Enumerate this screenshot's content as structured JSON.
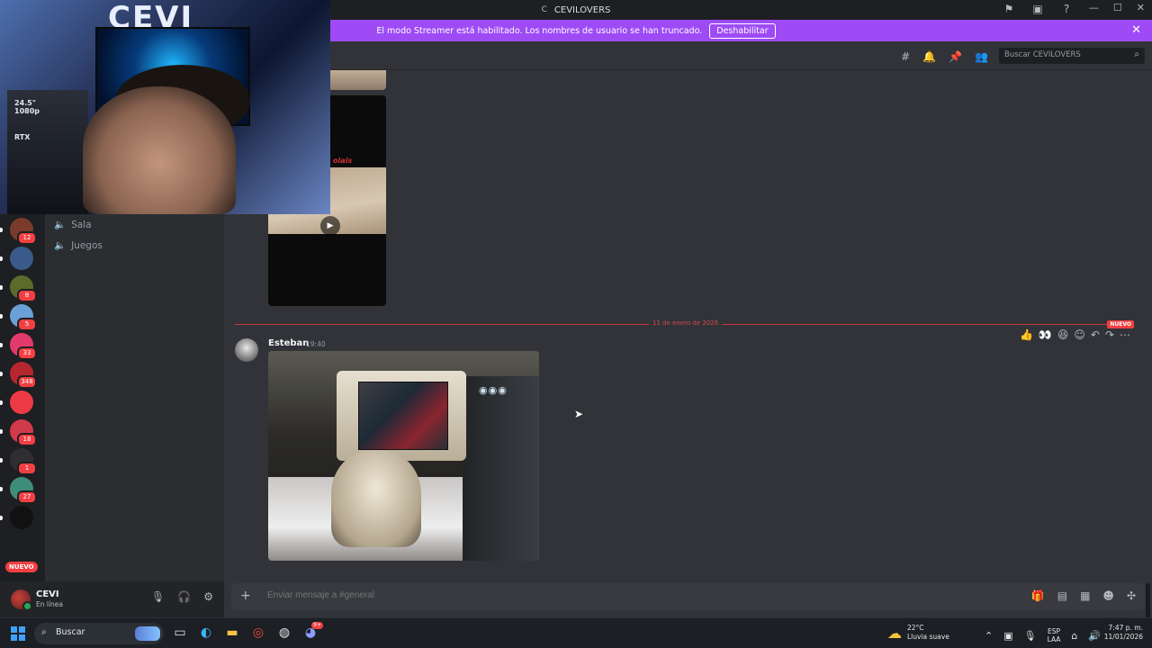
{
  "window": {
    "app_glyph": "C",
    "title": "CEVILOVERS",
    "icons": [
      "inbox-flag-icon",
      "streamer-screen-icon",
      "help-icon"
    ],
    "controls": [
      "minimize",
      "maximize",
      "close"
    ]
  },
  "streamer_banner": {
    "message": "El modo Streamer está habilitado. Los nombres de usuario se han truncado.",
    "button_label": "Deshabilitar",
    "bg_color": "#9e4bf6"
  },
  "header": {
    "icons": [
      "threads-icon",
      "bell-icon",
      "pin-icon",
      "members-icon"
    ],
    "search_placeholder": "Buscar CEVILOVERS"
  },
  "webcam": {
    "sign_text": "CEVI",
    "shelf_text_1": "24.5\"",
    "shelf_text_2": "1080p",
    "shelf_text_3": "RTX"
  },
  "servers": [
    {
      "badge": ""
    },
    {
      "badge": "3"
    },
    {
      "badge": "12"
    },
    {
      "badge": ""
    },
    {
      "badge": "8"
    },
    {
      "badge": "5"
    },
    {
      "badge": "33"
    },
    {
      "badge": "348"
    },
    {
      "badge": ""
    },
    {
      "badge": "18"
    },
    {
      "badge": "1"
    },
    {
      "badge": "27"
    },
    {
      "badge": ""
    }
  ],
  "new_pill": "NUEVO",
  "channels": [
    {
      "name": "Sala",
      "icon": "speaker-icon"
    },
    {
      "name": "Juegos",
      "icon": "speaker-icon"
    }
  ],
  "user": {
    "name": "CEVI",
    "status": "En línea",
    "status_color": "#23a55a"
  },
  "messages": {
    "prev_video_caption": "olais",
    "divider_date": "11 de enero de 2026",
    "new_tag": "NUEVO",
    "author": "Esteban",
    "time": "19:40",
    "reactions": [
      "👍",
      "👀",
      "😆"
    ],
    "actions": [
      "add-reaction-icon",
      "reply-icon",
      "forward-icon",
      "more-icon"
    ]
  },
  "composer": {
    "placeholder": "Enviar mensaje a #general",
    "tools": [
      "gift-icon",
      "gif-icon",
      "sticker-icon",
      "emoji-icon",
      "apps-icon"
    ]
  },
  "taskbar": {
    "search_label": "Buscar",
    "apps": [
      "file-explorer-multitask-icon",
      "edge-icon",
      "folder-icon",
      "chrome-icon",
      "obs-icon",
      "discord-icon"
    ],
    "discord_badge": "9+",
    "weather_temp": "22°C",
    "weather_desc": "Lluvia suave",
    "lang_1": "ESP",
    "lang_2": "LAA",
    "time": "7:47 p. m.",
    "date": "11/01/2026"
  }
}
